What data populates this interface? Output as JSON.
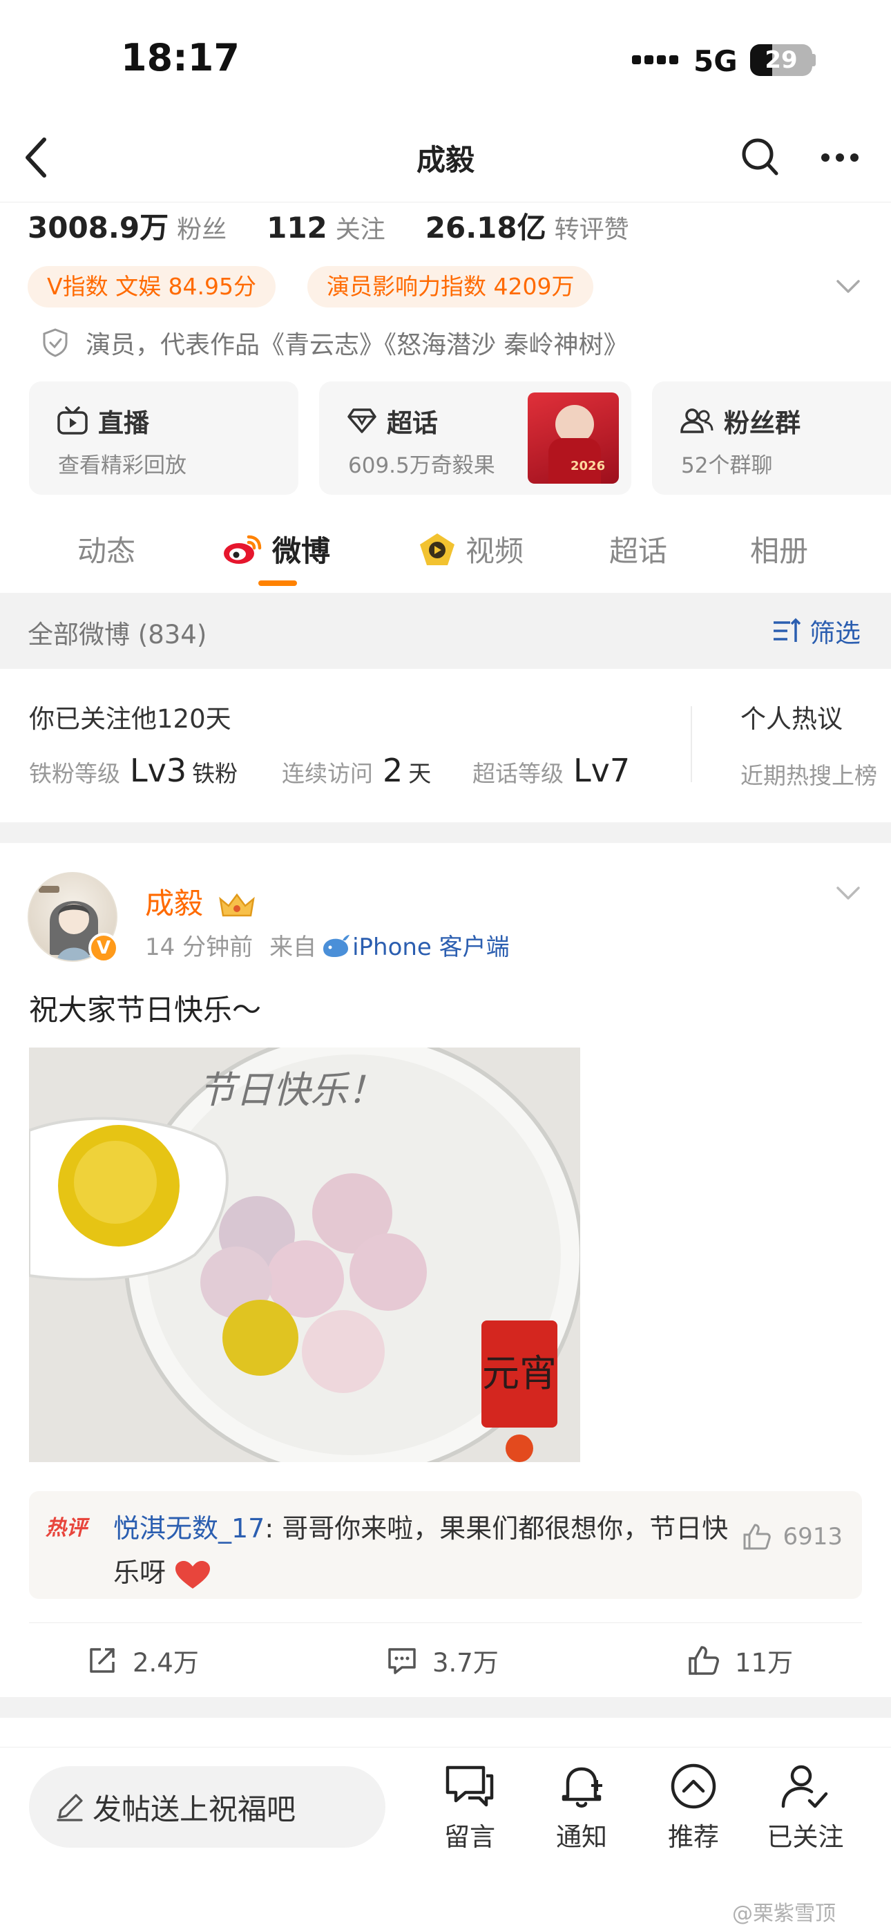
{
  "status_bar": {
    "time": "18:17",
    "network": "5G",
    "battery": "29"
  },
  "nav": {
    "title": "成毅"
  },
  "stats": [
    {
      "value": "3008.9万",
      "label": "粉丝"
    },
    {
      "value": "112",
      "label": "关注"
    },
    {
      "value": "26.18亿",
      "label": "转评赞"
    }
  ],
  "badges": {
    "v_index": "V指数 文娱 84.95分",
    "actor_index": "演员影响力指数 4209万"
  },
  "description": "演员，代表作品《青云志》《怒海潜沙 秦岭神树》",
  "cards": {
    "live": {
      "title": "直播",
      "sub": "查看精彩回放"
    },
    "supertopic": {
      "title": "超话",
      "sub": "609.5万奇毅果",
      "thumb_text": "2026"
    },
    "fans": {
      "title": "粉丝群",
      "sub": "52个群聊"
    }
  },
  "tabs": [
    "动态",
    "微博",
    "视频",
    "超话",
    "相册"
  ],
  "active_tab": "微博",
  "filter": {
    "label": "全部微博 (834)",
    "action": "筛选"
  },
  "follow": {
    "title": "你已关注他120天",
    "iron_label": "铁粉等级",
    "iron_value": "Lv3",
    "iron_suffix": "铁粉",
    "visit_label": "连续访问",
    "visit_value": "2",
    "visit_suffix": "天",
    "supertopic_label": "超话等级",
    "supertopic_value": "Lv7",
    "hot_title": "个人热议",
    "hot_sub": "近期热搜上榜"
  },
  "post": {
    "author": "成毅",
    "time": "14 分钟前",
    "from_label": "来自",
    "source": "iPhone 客户端",
    "text": "祝大家节日快乐～",
    "image_caption": "节日快乐！",
    "image_stamp": "元宵",
    "hot_comment": {
      "tag": "热评",
      "user": "悦淇无数_17",
      "text": ": 哥哥你来啦，果果们都很想你，节日快乐呀",
      "likes": "6913"
    },
    "actions": {
      "repost": "2.4万",
      "comment": "3.7万",
      "like": "11万"
    }
  },
  "bottom_bar": {
    "input_placeholder": "发帖送上祝福吧",
    "items": [
      "留言",
      "通知",
      "推荐",
      "已关注"
    ]
  },
  "watermark": "@栗紫雪顶",
  "colors": {
    "accent": "#ff8200",
    "link": "#2b5eb0",
    "name": "#ff6a00"
  }
}
